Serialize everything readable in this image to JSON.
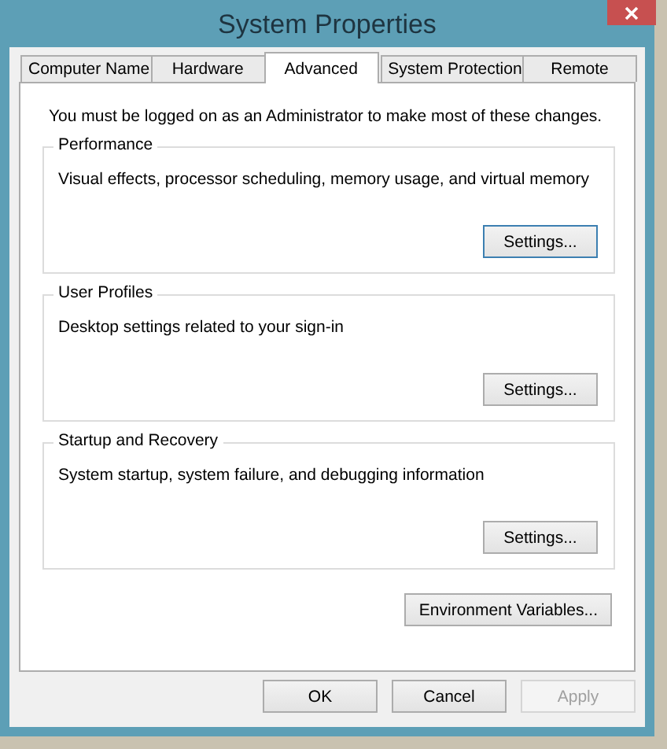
{
  "window": {
    "title": "System Properties"
  },
  "tabs": [
    {
      "label": "Computer Name",
      "selected": false
    },
    {
      "label": "Hardware",
      "selected": false
    },
    {
      "label": "Advanced",
      "selected": true
    },
    {
      "label": "System Protection",
      "selected": false
    },
    {
      "label": "Remote",
      "selected": false
    }
  ],
  "notice": "You must be logged on as an Administrator to make most of these changes.",
  "groups": [
    {
      "title": "Performance",
      "description": "Visual effects, processor scheduling, memory usage, and virtual memory",
      "button": {
        "label": "Settings...",
        "focused": true
      }
    },
    {
      "title": "User Profiles",
      "description": "Desktop settings related to your sign-in",
      "button": {
        "label": "Settings...",
        "focused": false
      }
    },
    {
      "title": "Startup and Recovery",
      "description": "System startup, system failure, and debugging information",
      "button": {
        "label": "Settings...",
        "focused": false
      }
    }
  ],
  "environment_button": {
    "label": "Environment Variables...",
    "focused": false
  },
  "buttons": [
    {
      "label": "OK",
      "disabled": false
    },
    {
      "label": "Cancel",
      "disabled": false
    },
    {
      "label": "Apply",
      "disabled": true
    }
  ]
}
